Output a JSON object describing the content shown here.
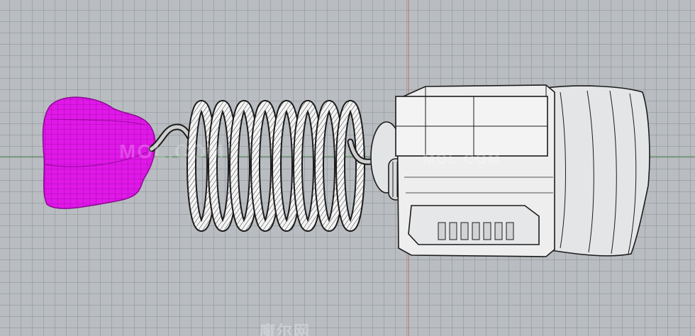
{
  "viewport": {
    "background": "#b9bdc1",
    "grid_color": "#8c9298",
    "axis_x_color": "#5f8f65",
    "axis_y_color": "#c07a70"
  },
  "model": {
    "head_color": "#e018e8",
    "wire_color": "#1b1b1b",
    "body_fill": "#e9eaeb"
  },
  "watermarks": {
    "center": "MOL.COM",
    "right": "MOL.COM",
    "bottom": "魔尔网"
  }
}
